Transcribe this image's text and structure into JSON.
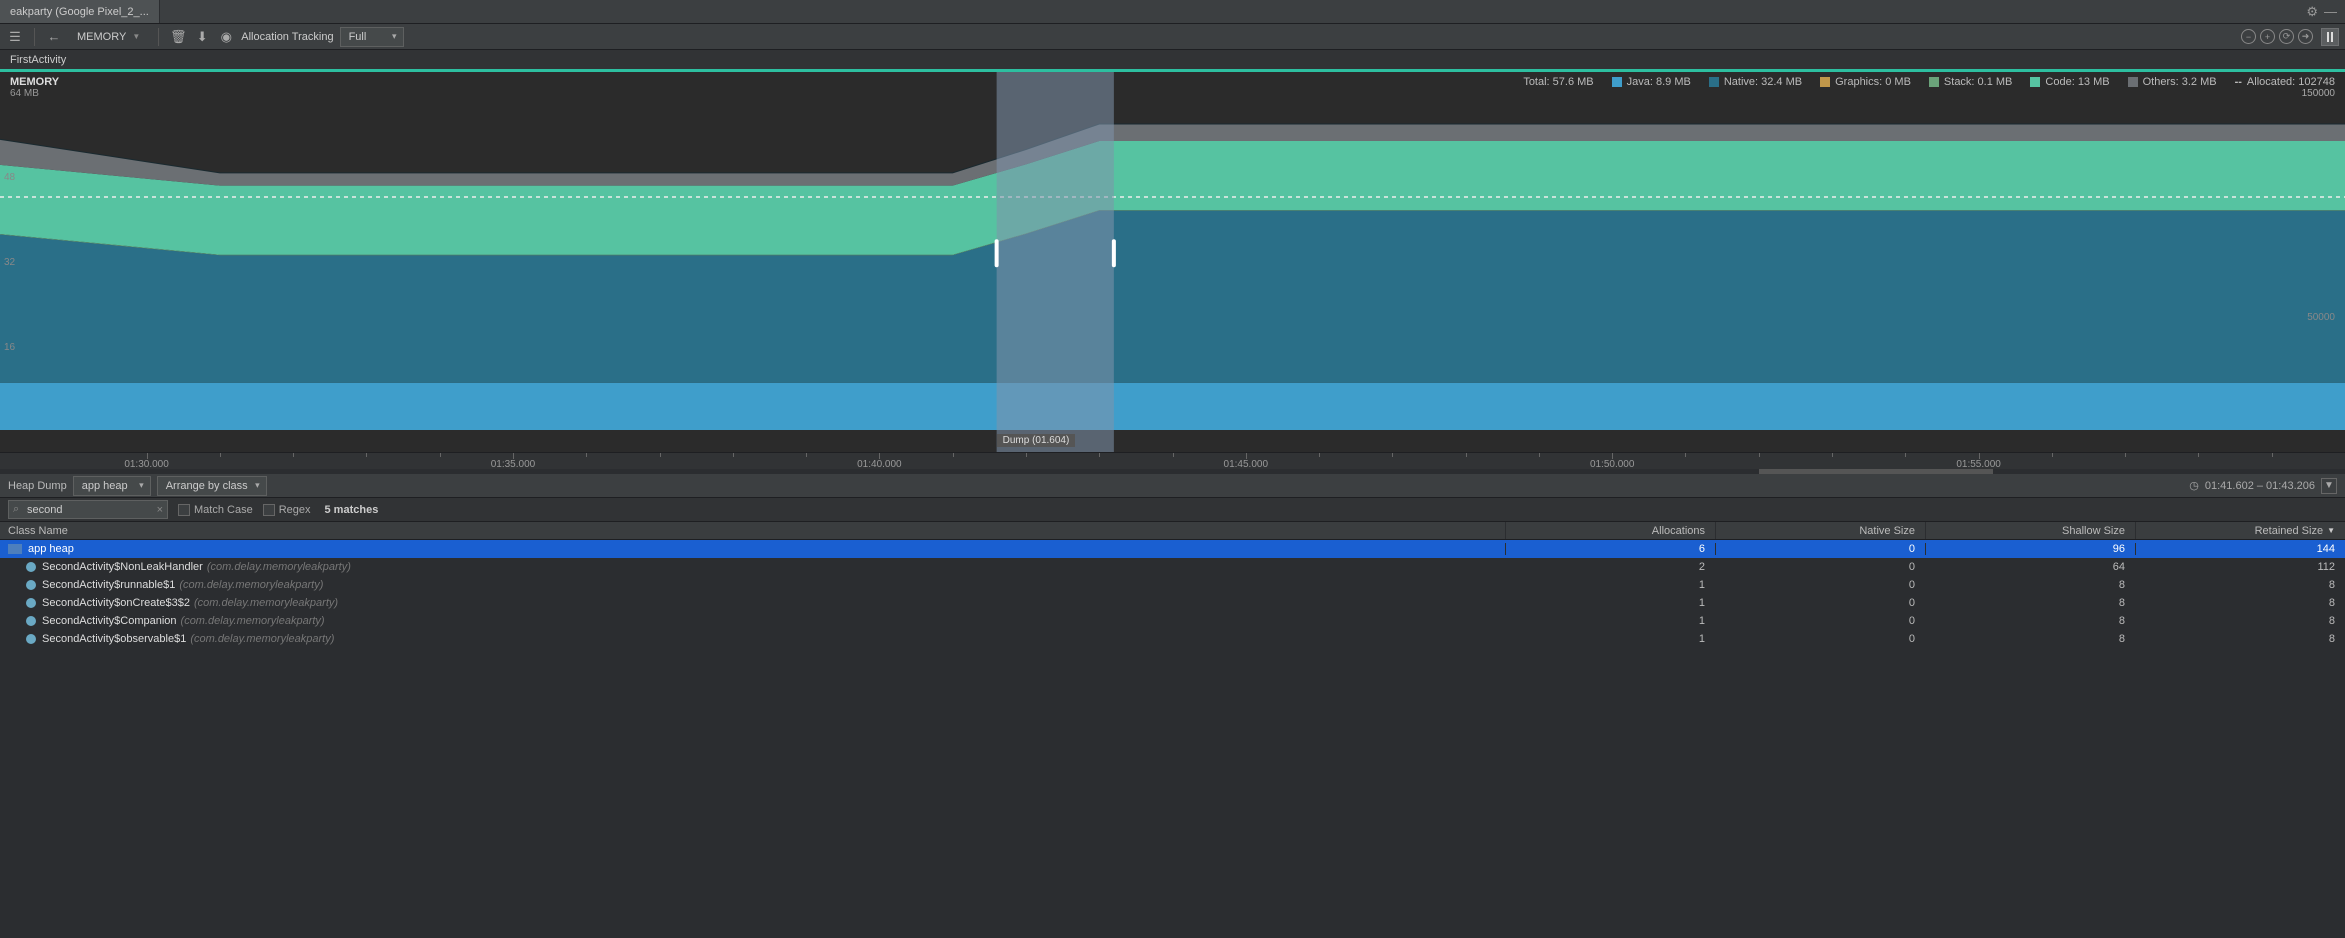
{
  "tab": {
    "title": "eakparty (Google Pixel_2_..."
  },
  "toolbar": {
    "memory_dropdown": "MEMORY",
    "alloc_tracking_label": "Allocation Tracking",
    "alloc_mode": "Full"
  },
  "breadcrumb": {
    "activity": "FirstActivity"
  },
  "chart": {
    "title": "MEMORY",
    "ymax_label": "64 MB",
    "yticks": [
      "48",
      "32",
      "16"
    ],
    "right_top": "150000",
    "right_mid": "50000",
    "dump_badge": "Dump (01.604)",
    "timeline_ticks": [
      "01:30.000",
      "01:35.000",
      "01:40.000",
      "01:45.000",
      "01:50.000",
      "01:55.000"
    ],
    "legend": {
      "total": "Total: 57.6 MB",
      "java": "Java: 8.9 MB",
      "native": "Native: 32.4 MB",
      "graphics": "Graphics: 0 MB",
      "stack": "Stack: 0.1 MB",
      "code": "Code: 13 MB",
      "others": "Others: 3.2 MB",
      "allocated": "Allocated: 102748"
    },
    "colors": {
      "java": "#3f9ecb",
      "native": "#2a6f88",
      "graphics": "#c0974a",
      "stack": "#6aa37a",
      "code": "#56c3a1",
      "others": "#6b6f73",
      "selection": "#8094ac"
    }
  },
  "chart_data": {
    "type": "area",
    "xlabel": "time",
    "ylabel": "MB",
    "ylim": [
      0,
      64
    ],
    "x_ticks_sec": [
      90,
      95,
      100,
      105,
      110,
      115
    ],
    "selection_sec": [
      101.6,
      103.2
    ],
    "series": [
      {
        "name": "Java",
        "color": "#3f9ecb",
        "points": [
          [
            90,
            8.9
          ],
          [
            101,
            8.9
          ],
          [
            102,
            8.9
          ],
          [
            103,
            8.9
          ],
          [
            120,
            8.9
          ]
        ]
      },
      {
        "name": "Native",
        "color": "#2a6f88",
        "points": [
          [
            90,
            25.3
          ],
          [
            91,
            24.0
          ],
          [
            101,
            24.0
          ],
          [
            102,
            28.0
          ],
          [
            103,
            32.4
          ],
          [
            120,
            32.4
          ]
        ]
      },
      {
        "name": "Graphics",
        "color": "#c0974a",
        "points": [
          [
            90,
            0
          ],
          [
            120,
            0
          ]
        ]
      },
      {
        "name": "Stack",
        "color": "#6aa37a",
        "points": [
          [
            90,
            0.1
          ],
          [
            120,
            0.1
          ]
        ]
      },
      {
        "name": "Code",
        "color": "#56c3a1",
        "points": [
          [
            90,
            13
          ],
          [
            120,
            13
          ]
        ]
      },
      {
        "name": "Others",
        "color": "#6b6f73",
        "points": [
          [
            90,
            3.2
          ],
          [
            91,
            2.4
          ],
          [
            101,
            2.4
          ],
          [
            103,
            3.2
          ],
          [
            120,
            3.2
          ]
        ]
      }
    ],
    "allocated_line": {
      "name": "Allocated",
      "points": [
        [
          90,
          102748
        ],
        [
          120,
          102748
        ]
      ],
      "ylim": [
        0,
        150000
      ]
    }
  },
  "heap": {
    "panel_label": "Heap Dump",
    "heap_select": "app heap",
    "arrange_select": "Arrange by class",
    "time_range": "01:41.602 – 01:43.206",
    "search_value": "second",
    "match_case": "Match Case",
    "regex": "Regex",
    "matches": "5 matches",
    "columns": [
      "Class Name",
      "Allocations",
      "Native Size",
      "Shallow Size",
      "Retained Size"
    ],
    "rows": [
      {
        "depth": 0,
        "icon": "folder",
        "name": "app heap",
        "pkg": "",
        "alloc": "6",
        "native": "0",
        "shallow": "96",
        "retained": "144",
        "selected": true
      },
      {
        "depth": 1,
        "icon": "class",
        "name": "SecondActivity$NonLeakHandler",
        "pkg": "(com.delay.memoryleakparty)",
        "alloc": "2",
        "native": "0",
        "shallow": "64",
        "retained": "112"
      },
      {
        "depth": 1,
        "icon": "class",
        "name": "SecondActivity$runnable$1",
        "pkg": "(com.delay.memoryleakparty)",
        "alloc": "1",
        "native": "0",
        "shallow": "8",
        "retained": "8"
      },
      {
        "depth": 1,
        "icon": "class",
        "name": "SecondActivity$onCreate$3$2",
        "pkg": "(com.delay.memoryleakparty)",
        "alloc": "1",
        "native": "0",
        "shallow": "8",
        "retained": "8"
      },
      {
        "depth": 1,
        "icon": "class",
        "name": "SecondActivity$Companion",
        "pkg": "(com.delay.memoryleakparty)",
        "alloc": "1",
        "native": "0",
        "shallow": "8",
        "retained": "8"
      },
      {
        "depth": 1,
        "icon": "class",
        "name": "SecondActivity$observable$1",
        "pkg": "(com.delay.memoryleakparty)",
        "alloc": "1",
        "native": "0",
        "shallow": "8",
        "retained": "8"
      }
    ]
  }
}
